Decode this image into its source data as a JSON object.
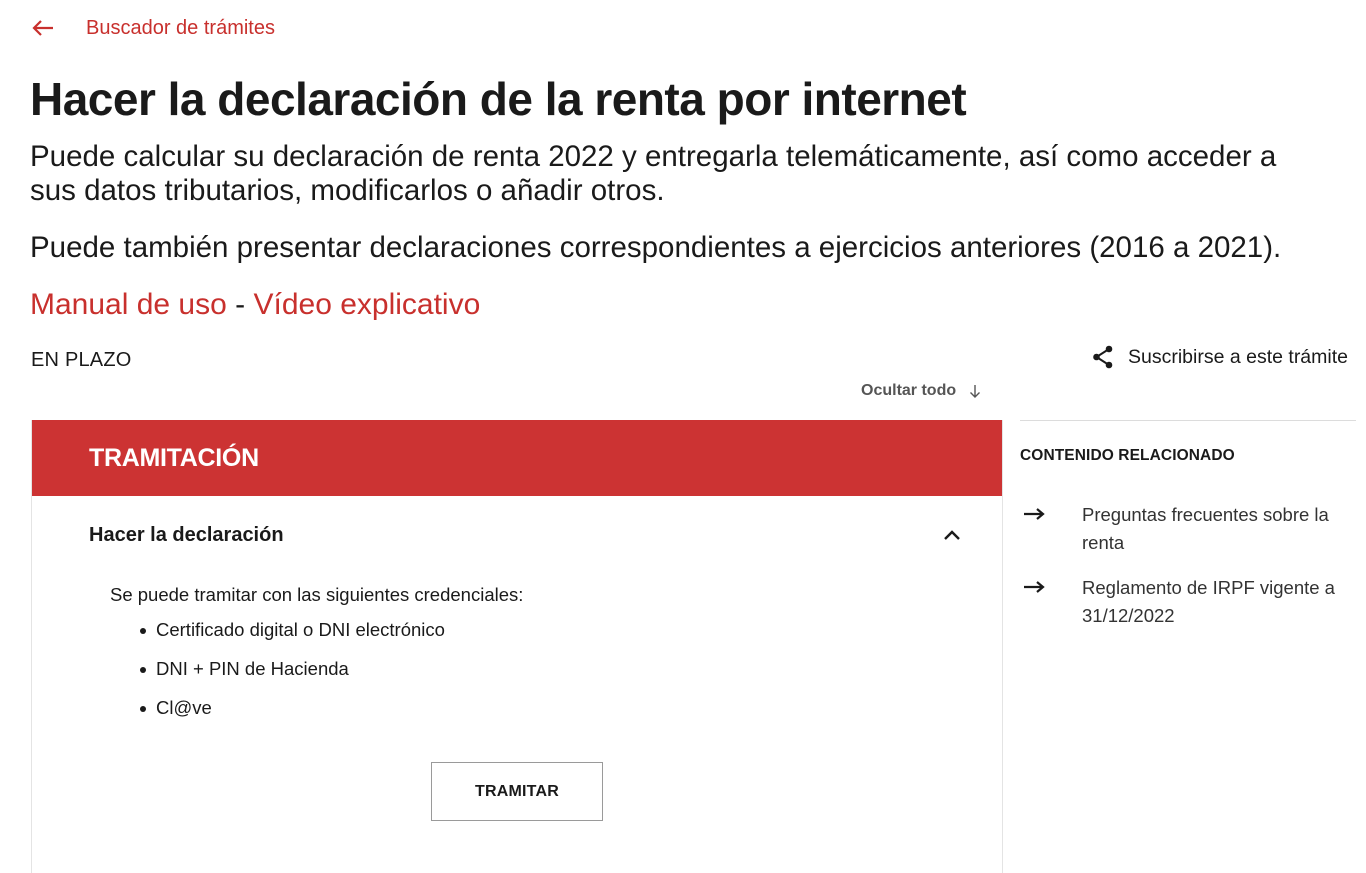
{
  "nav": {
    "back_label": "Buscador de trámites"
  },
  "page": {
    "title": "Hacer la declaración de la renta por internet",
    "description_1": "Puede calcular su declaración de renta 2022 y entregarla telemáticamente, así como acceder a sus datos tributarios, modificarlos o añadir otros.",
    "description_2": "Puede también presentar declaraciones correspondientes a ejercicios anteriores (2016 a 2021).",
    "links": {
      "manual": "Manual de uso",
      "separator": " - ",
      "video": "Vídeo explicativo"
    },
    "status": "EN PLAZO",
    "subscribe_label": "Suscribirse a este trámite",
    "hide_all_label": "Ocultar todo"
  },
  "panel": {
    "header": "TRAMITACIÓN",
    "accordion_title": "Hacer la declaración",
    "intro": "Se puede tramitar con las siguientes credenciales:",
    "credentials": [
      "Certificado digital o DNI electrónico",
      "DNI + PIN de Hacienda",
      "Cl@ve"
    ],
    "button_label": "TRAMITAR"
  },
  "related": {
    "title": "CONTENIDO RELACIONADO",
    "items": [
      "Preguntas frecuentes sobre la renta",
      "Reglamento de IRPF vigente a 31/12/2022"
    ]
  },
  "colors": {
    "accent": "#cc3333",
    "text": "#1a1a1a"
  }
}
